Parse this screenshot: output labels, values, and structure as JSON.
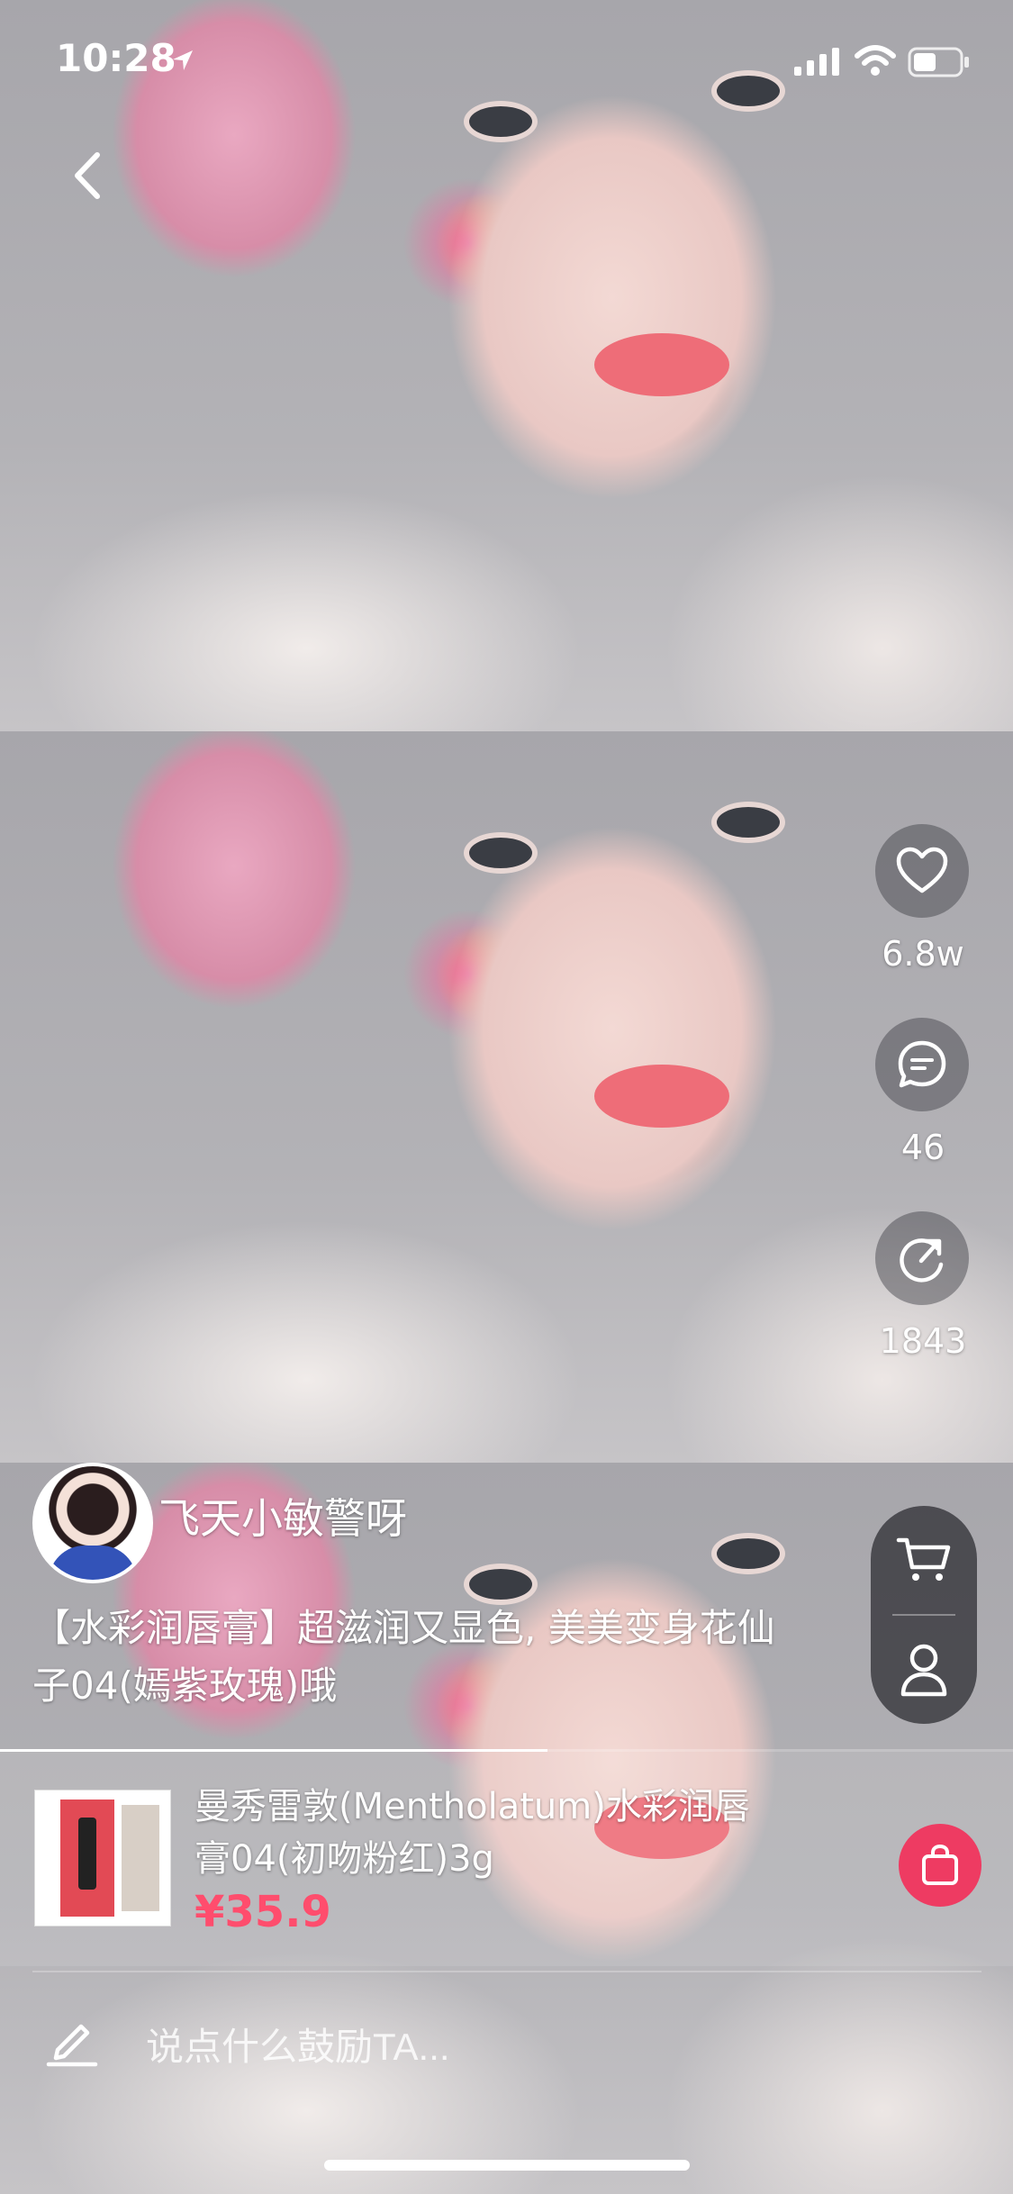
{
  "status_bar": {
    "time": "10:28"
  },
  "actions": {
    "likes": "6.8w",
    "comments": "46",
    "shares": "1843"
  },
  "author": {
    "name": "飞天小敏警呀"
  },
  "caption": "【水彩润唇膏】超滋润又显色, 美美变身花仙子04(嫣紫玫瑰)哦",
  "video": {
    "progress": 0.54
  },
  "product": {
    "title": "曼秀雷敦(Mentholatum)水彩润唇膏04(初吻粉红)3g",
    "price": "¥35.9"
  },
  "comment_input": {
    "placeholder": "说点什么鼓励TA..."
  },
  "colors": {
    "price": "#ff4d6d",
    "buy_button": "#ee3b62"
  },
  "icons": {
    "back": "back-icon",
    "like": "heart-icon",
    "comment": "comment-icon",
    "share": "share-icon",
    "cart": "cart-icon",
    "profile": "profile-icon",
    "buy": "shopping-bag-icon",
    "edit": "pen-icon"
  }
}
